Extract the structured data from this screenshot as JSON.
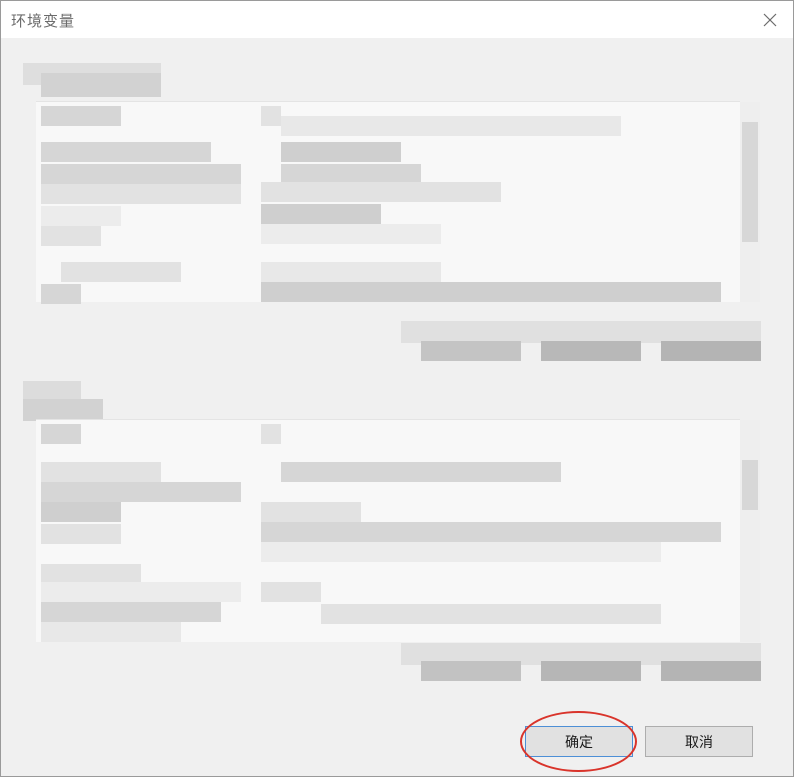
{
  "window": {
    "title": "环境变量",
    "close_icon": "close-icon"
  },
  "buttons": {
    "ok_label": "确定",
    "cancel_label": "取消"
  },
  "annotation": {
    "highlight_color": "#d9342b"
  }
}
